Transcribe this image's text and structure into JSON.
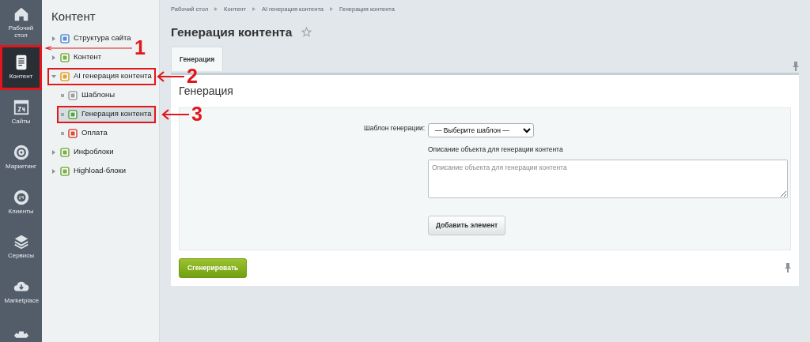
{
  "sidebar": {
    "items": [
      {
        "label": "Рабочий стол",
        "selected": false,
        "highlighted": false
      },
      {
        "label": "Контент",
        "selected": true,
        "highlighted": true
      },
      {
        "label": "Сайты",
        "selected": false,
        "highlighted": false
      },
      {
        "label": "Маркетинг",
        "selected": false,
        "highlighted": false
      },
      {
        "label": "Клиенты",
        "selected": false,
        "highlighted": false
      },
      {
        "label": "Сервисы",
        "selected": false,
        "highlighted": false
      },
      {
        "label": "Marketplace",
        "selected": false,
        "highlighted": false
      }
    ]
  },
  "menu": {
    "title": "Контент",
    "items": [
      {
        "label": "Структура сайта",
        "expanded": false,
        "selected": false,
        "highlighted": false
      },
      {
        "label": "Контент",
        "expanded": false,
        "selected": false,
        "highlighted": false
      },
      {
        "label": "AI генерация контента",
        "expanded": true,
        "selected": false,
        "highlighted": true,
        "children": [
          {
            "label": "Шаблоны",
            "selected": false,
            "highlighted": false
          },
          {
            "label": "Генерация контента",
            "selected": true,
            "highlighted": true
          },
          {
            "label": "Оплата",
            "selected": false,
            "highlighted": false
          }
        ]
      },
      {
        "label": "Инфоблоки",
        "expanded": false,
        "selected": false,
        "highlighted": false
      },
      {
        "label": "Highload-блоки",
        "expanded": false,
        "selected": false,
        "highlighted": false
      }
    ]
  },
  "breadcrumbs": [
    "Рабочий стол",
    "Контент",
    "AI генерация контента",
    "Генерация контента"
  ],
  "page_title": "Генерация контента",
  "tabs": [
    {
      "label": "Генерация",
      "selected": true
    }
  ],
  "form": {
    "heading": "Генерация",
    "template_label": "Шаблон генерации:",
    "template_value": "— Выберите шаблон —",
    "description_label": "Описание объекта для генерации контента",
    "description_placeholder": "Описание объекта для генерации контента",
    "add_button": "Добавить элемент"
  },
  "submit_button": "Сгенерировать",
  "annotations": [
    {
      "number": "1"
    },
    {
      "number": "2"
    },
    {
      "number": "3"
    }
  ]
}
